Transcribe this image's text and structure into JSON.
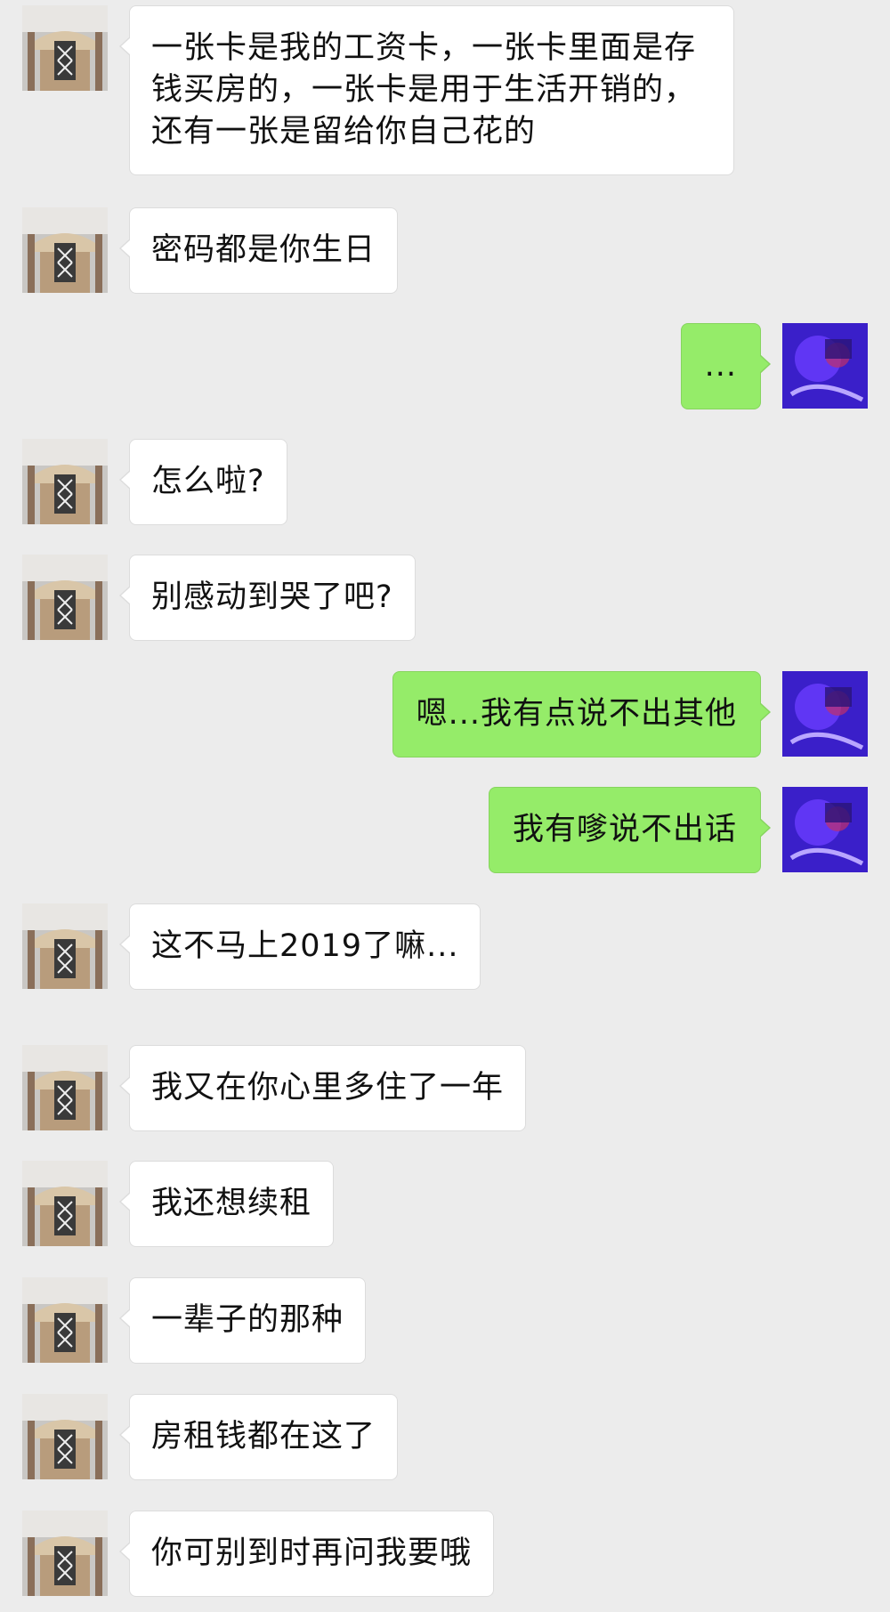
{
  "conversation": {
    "messages": [
      {
        "sender": "contact",
        "text": "一张卡是我的工资卡，一张卡里面是存钱买房的，一张卡是用于生活开销的，还有一张是留给你自己花的"
      },
      {
        "sender": "contact",
        "text": "密码都是你生日"
      },
      {
        "sender": "me",
        "text": "..."
      },
      {
        "sender": "contact",
        "text": "怎么啦?"
      },
      {
        "sender": "contact",
        "text": "别感动到哭了吧?"
      },
      {
        "sender": "me",
        "text": "嗯...我有点说不出其他"
      },
      {
        "sender": "me",
        "text": "我有嗲说不出话"
      },
      {
        "sender": "contact",
        "text": "这不马上2019了嘛..."
      },
      {
        "sender": "contact",
        "text": "我又在你心里多住了一年"
      },
      {
        "sender": "contact",
        "text": "我还想续租"
      },
      {
        "sender": "contact",
        "text": "一辈子的那种"
      },
      {
        "sender": "contact",
        "text": "房租钱都在这了"
      },
      {
        "sender": "contact",
        "text": "你可别到时再问我要哦"
      }
    ]
  },
  "icons": {
    "contact_avatar": "contact-avatar-photo",
    "my_avatar": "my-avatar-photo"
  },
  "colors": {
    "background": "#ececec",
    "incoming_bubble": "#ffffff",
    "outgoing_bubble": "#95ec69"
  }
}
